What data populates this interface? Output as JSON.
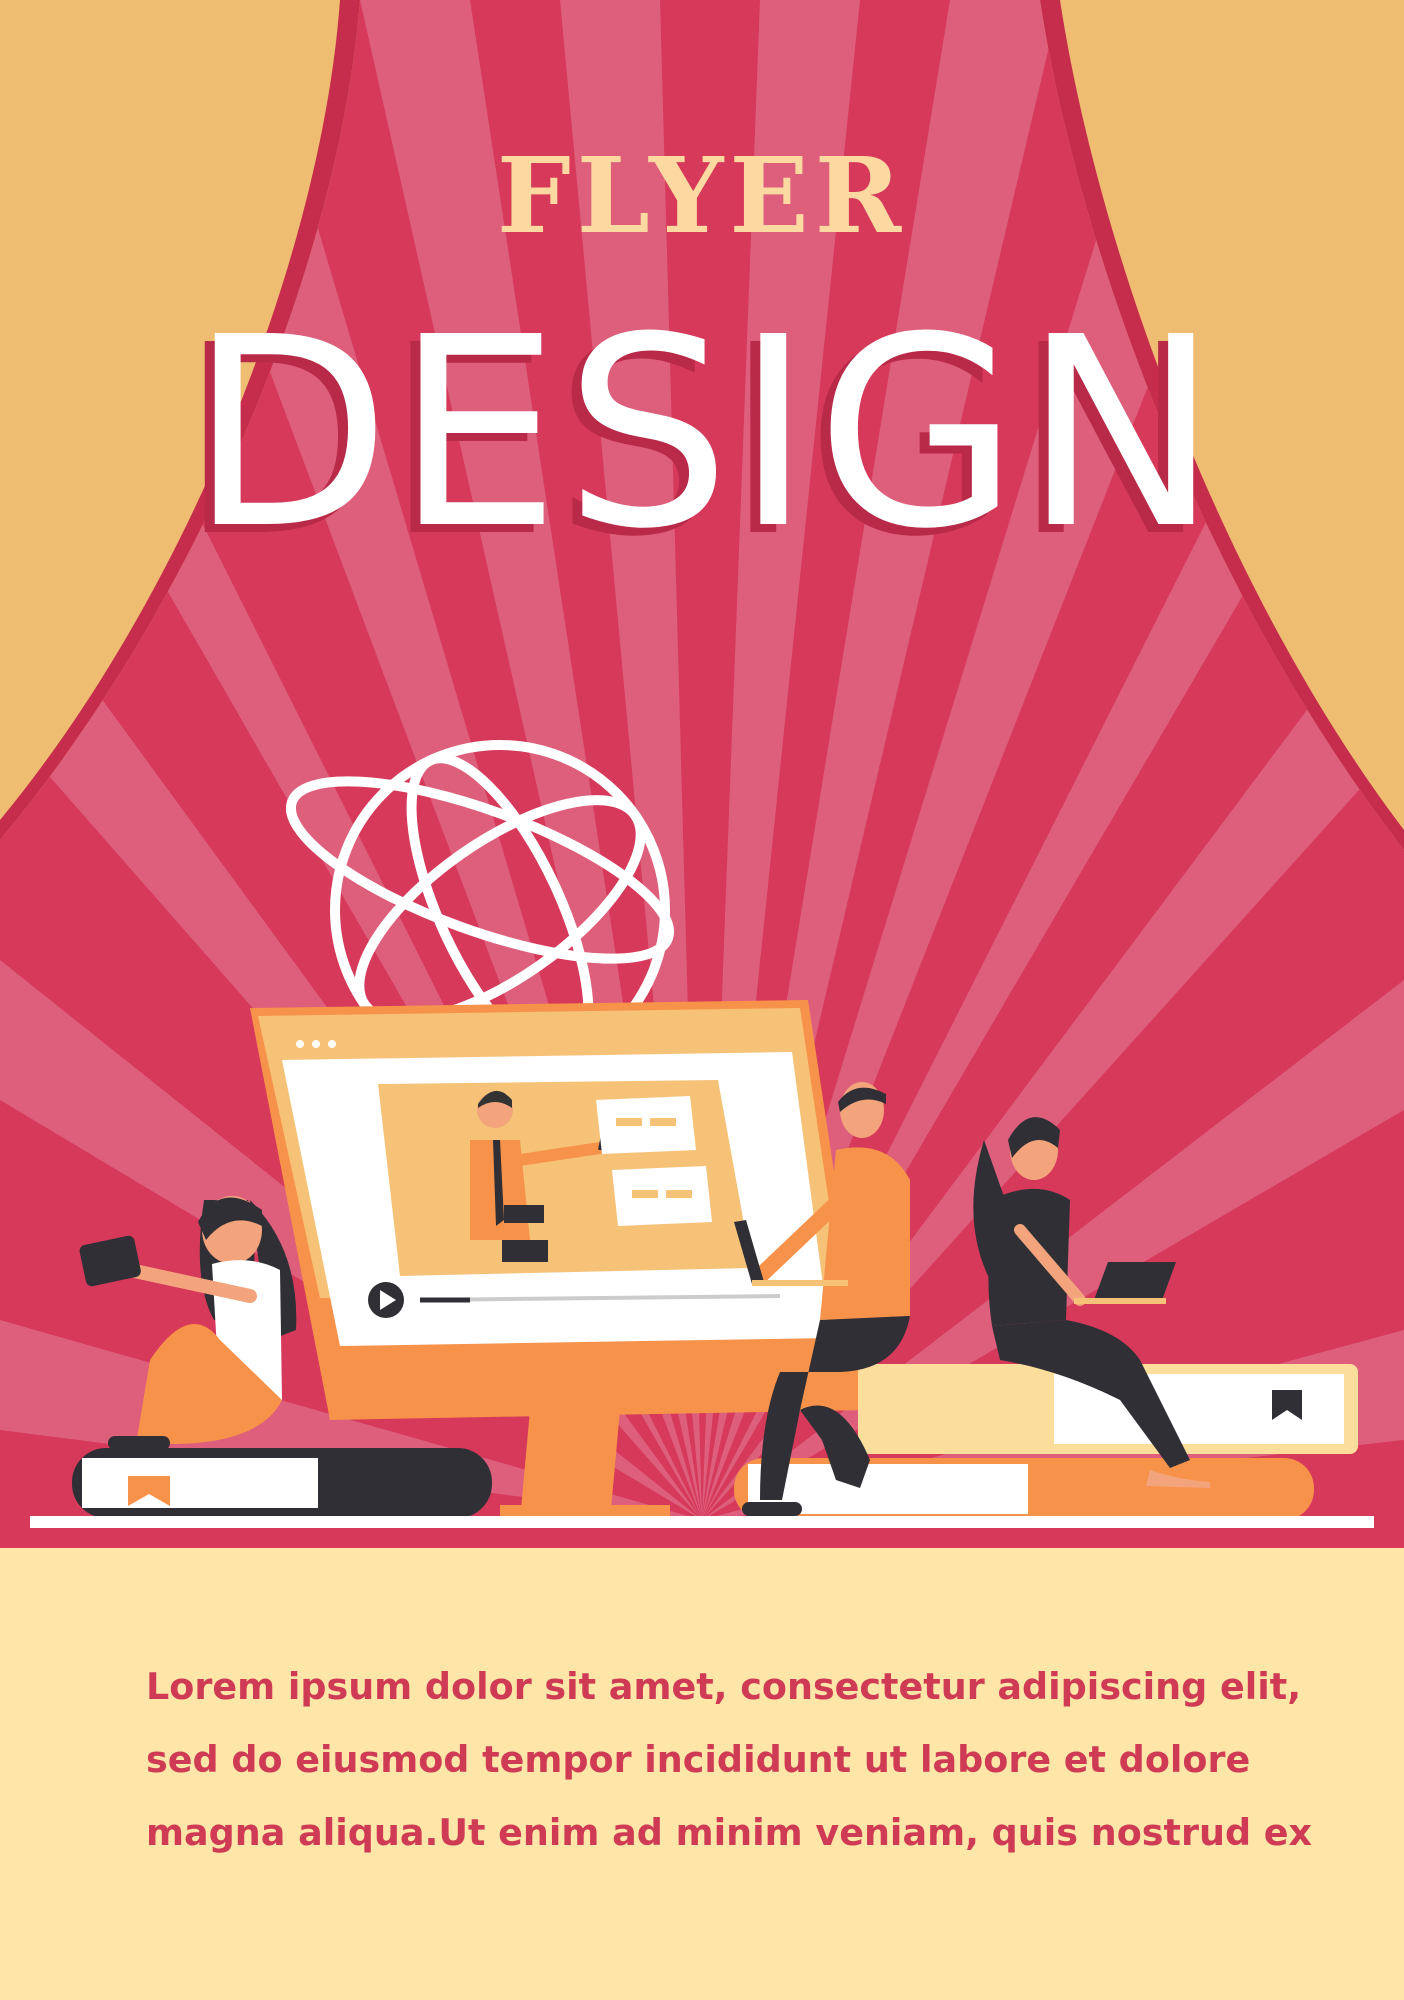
{
  "header": {
    "kicker": "FLYER",
    "title": "DESIGN"
  },
  "body_text": [
    "Lorem ipsum dolor sit amet, consectetur adipiscing elit,",
    "sed do eiusmod tempor incididunt ut labore et dolore",
    "magna aliqua.Ut enim ad minim veniam, quis nostrud ex"
  ],
  "colors": {
    "background_red": "#d6395a",
    "ray_pink": "#de5f7c",
    "curtain_gold": "#eebd72",
    "kicker_text": "#fbd9a0",
    "title_text": "#ffffff",
    "panel": "#fde6a8",
    "body_text": "#cf3a55",
    "accent_orange": "#f7924a"
  },
  "icons": [
    "globe-icon",
    "play-icon",
    "bookmark-icon",
    "laptop-icon",
    "tablet-icon"
  ]
}
